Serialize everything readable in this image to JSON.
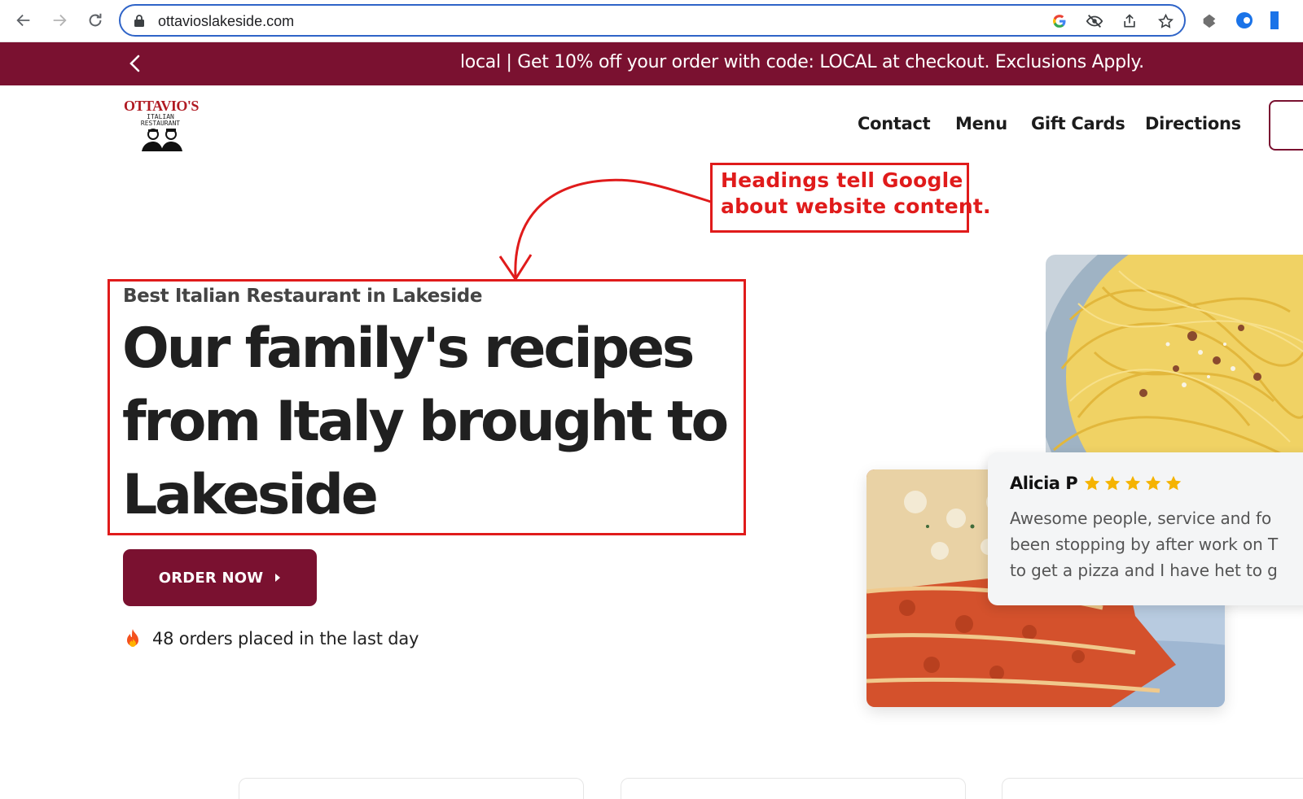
{
  "browser": {
    "url": "ottavioslakeside.com",
    "icons": [
      "back-icon",
      "forward-icon",
      "reload-icon",
      "lock-icon",
      "google-icon",
      "eye-off-icon",
      "share-icon",
      "star-icon",
      "extension-icon",
      "profile-icon"
    ]
  },
  "banner": {
    "text": "local | Get 10% off your order with code: LOCAL at checkout. Exclusions Apply.",
    "background": "#7a1130"
  },
  "logo": {
    "brand": "OTTAVIO'S",
    "sub1": "ITALIAN",
    "sub2": "RESTAURANT"
  },
  "nav": {
    "items": [
      {
        "label": "Contact"
      },
      {
        "label": "Menu"
      },
      {
        "label": "Gift Cards"
      },
      {
        "label": "Directions"
      }
    ]
  },
  "annotation": {
    "line1": "Headings tell Google",
    "line2": "about website content.",
    "color": "#e01b1b"
  },
  "hero": {
    "eyebrow": "Best Italian Restaurant in Lakeside",
    "heading_lines": [
      "Our family's recipes",
      "from Italy brought to",
      "Lakeside"
    ],
    "cta_label": "ORDER NOW",
    "orders_text": "48 orders placed in the last day"
  },
  "review": {
    "name": "Alicia P",
    "rating": 5,
    "lines": [
      "Awesome people, service and fo",
      "been stopping by after work on T",
      "to get a pizza and I have het to g"
    ],
    "star_color": "#f5b301"
  }
}
